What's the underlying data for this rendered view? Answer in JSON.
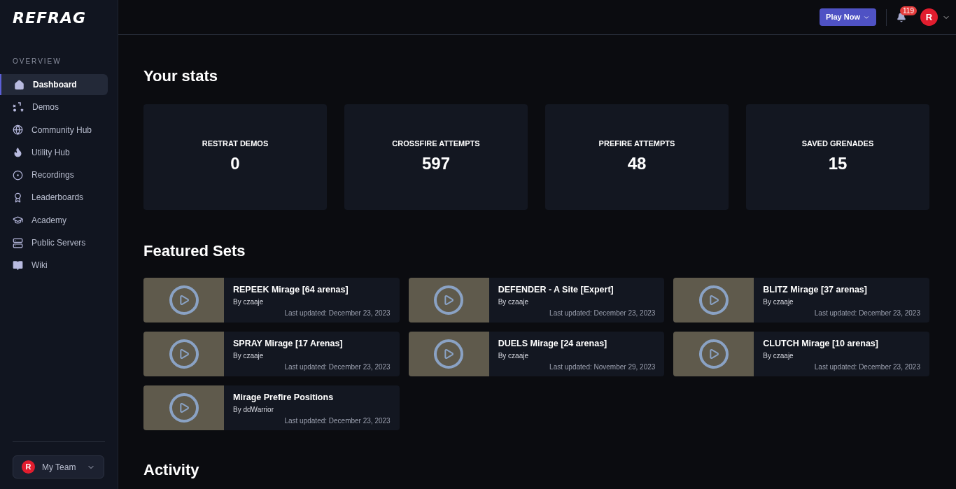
{
  "logo": "REFRAG",
  "sidebar": {
    "section": "OVERVIEW",
    "items": [
      {
        "label": "Dashboard",
        "selected": true
      },
      {
        "label": "Demos",
        "selected": false
      },
      {
        "label": "Community Hub",
        "selected": false
      },
      {
        "label": "Utility Hub",
        "selected": false
      },
      {
        "label": "Recordings",
        "selected": false
      },
      {
        "label": "Leaderboards",
        "selected": false
      },
      {
        "label": "Academy",
        "selected": false
      },
      {
        "label": "Public Servers",
        "selected": false
      },
      {
        "label": "Wiki",
        "selected": false
      }
    ],
    "team": {
      "avatar": "R",
      "label": "My Team"
    }
  },
  "topbar": {
    "play_button": "Play Now",
    "notifications": "119",
    "avatar": "R"
  },
  "stats": {
    "title": "Your stats",
    "cards": [
      {
        "label": "RESTRAT DEMOS",
        "value": "0"
      },
      {
        "label": "CROSSFIRE ATTEMPTS",
        "value": "597"
      },
      {
        "label": "PREFIRE ATTEMPTS",
        "value": "48"
      },
      {
        "label": "SAVED GRENADES",
        "value": "15"
      }
    ]
  },
  "featured": {
    "title": "Featured Sets",
    "sets": [
      {
        "title": "REPEEK Mirage [64 arenas]",
        "author": "By czaaje",
        "updated": "Last updated: December 23, 2023"
      },
      {
        "title": "DEFENDER - A Site [Expert]",
        "author": "By czaaje",
        "updated": "Last updated: December 23, 2023"
      },
      {
        "title": "BLITZ Mirage [37 arenas]",
        "author": "By czaaje",
        "updated": "Last updated: December 23, 2023"
      },
      {
        "title": "SPRAY Mirage [17 Arenas]",
        "author": "By czaaje",
        "updated": "Last updated: December 23, 2023"
      },
      {
        "title": "DUELS Mirage [24 arenas]",
        "author": "By czaaje",
        "updated": "Last updated: November 29, 2023"
      },
      {
        "title": "CLUTCH Mirage [10 arenas]",
        "author": "By czaaje",
        "updated": "Last updated: December 23, 2023"
      },
      {
        "title": "Mirage Prefire Positions",
        "author": "By ddWarrior",
        "updated": "Last updated: December 23, 2023"
      }
    ]
  },
  "activity": {
    "title": "Activity"
  }
}
